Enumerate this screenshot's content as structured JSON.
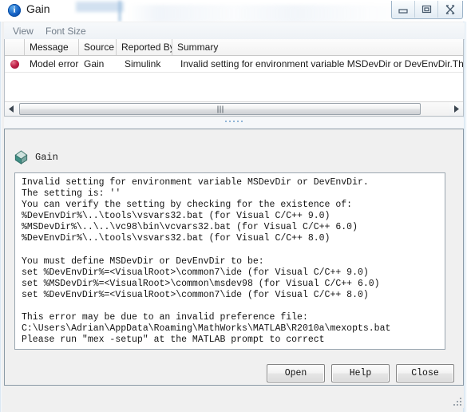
{
  "window": {
    "title": "Gain",
    "icon": "info-circle-icon",
    "controls": {
      "minimize": "minimize-icon",
      "restore": "restore-icon",
      "close": "close-icon"
    }
  },
  "menubar": {
    "items": [
      {
        "label": "View"
      },
      {
        "label": "Font Size"
      }
    ]
  },
  "table": {
    "columns": [
      "",
      "Message",
      "Source",
      "Reported By",
      "Summary"
    ],
    "rows": [
      {
        "icon": "error-dot-icon",
        "message": "Model error",
        "source": "Gain",
        "reported_by": "Simulink",
        "summary": "Invalid setting for environment variable MSDevDir or DevEnvDir.The se"
      }
    ]
  },
  "scrollbar": {
    "left_arrow": "arrow-left-icon",
    "right_arrow": "arrow-right-icon",
    "grip": "scrollbar-grip"
  },
  "splitter": {
    "handle": "splitter-handle"
  },
  "detail": {
    "icon": "simulink-block-icon",
    "title": "Gain",
    "message": "Invalid setting for environment variable MSDevDir or DevEnvDir.\nThe setting is: ''\nYou can verify the setting by checking for the existence of:\n%DevEnvDir%\\..\\tools\\vsvars32.bat (for Visual C/C++ 9.0)\n%MSDevDir%\\..\\..\\vc98\\bin\\vcvars32.bat (for Visual C/C++ 6.0)\n%DevEnvDir%\\..\\tools\\vsvars32.bat (for Visual C/C++ 8.0)\n\nYou must define MSDevDir or DevEnvDir to be:\nset %DevEnvDir%=<VisualRoot>\\common7\\ide (for Visual C/C++ 9.0)\nset %MSDevDir%=<VisualRoot>\\common\\msdev98 (for Visual C/C++ 6.0)\nset %DevEnvDir%=<VisualRoot>\\common7\\ide (for Visual C/C++ 8.0)\n\nThis error may be due to an invalid preference file:\nC:\\Users\\Adrian\\AppData\\Roaming\\MathWorks\\MATLAB\\R2010a\\mexopts.bat\nPlease run \"mex -setup\" at the MATLAB prompt to correct"
  },
  "buttons": {
    "open": "Open",
    "help": "Help",
    "close": "Close"
  },
  "colors": {
    "error_dot": "#c2234a",
    "accent_blue": "#1562c6",
    "block_icon_teal": "#3f8f84",
    "window_bg": "#f0f0f0",
    "panel_bg": "#ffffff"
  }
}
